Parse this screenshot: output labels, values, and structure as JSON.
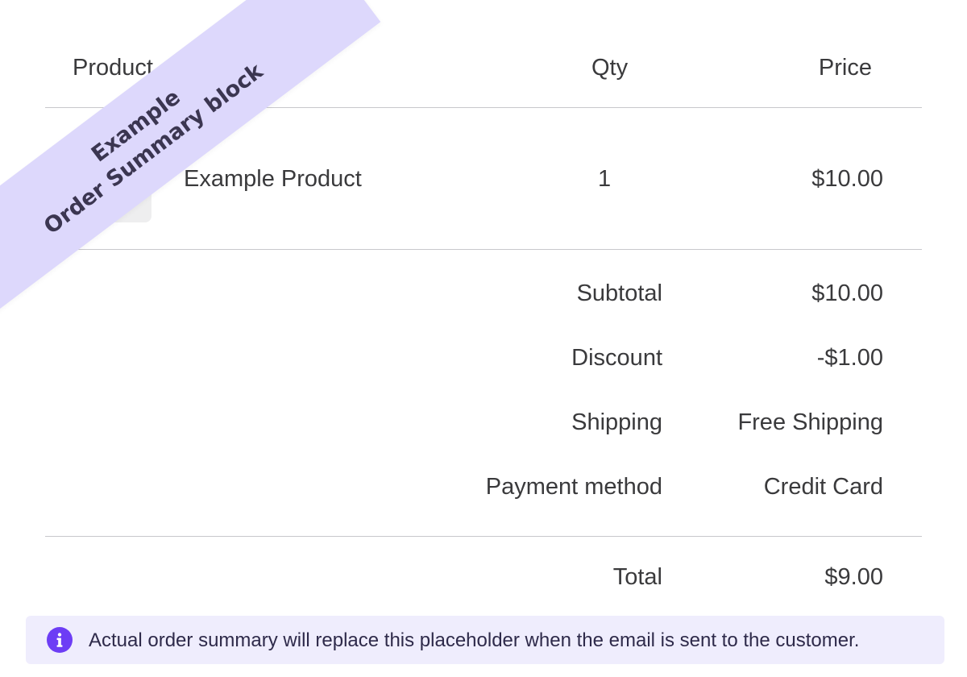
{
  "table": {
    "headers": {
      "product": "Product",
      "qty": "Qty",
      "price": "Price"
    },
    "items": [
      {
        "name": "Example Product",
        "qty": "1",
        "price": "$10.00",
        "thumbnail_icon": "image-placeholder-icon"
      }
    ]
  },
  "summary": {
    "rows": [
      {
        "label": "Subtotal",
        "value": "$10.00"
      },
      {
        "label": "Discount",
        "value": "-$1.00"
      },
      {
        "label": "Shipping",
        "value": "Free Shipping"
      },
      {
        "label": "Payment method",
        "value": "Credit Card"
      }
    ],
    "total": {
      "label": "Total",
      "value": "$9.00"
    }
  },
  "notice": {
    "icon": "info-icon",
    "text": "Actual order summary will replace this placeholder when the email is sent to the customer."
  },
  "ribbon": {
    "line1": "Example",
    "line2": "Order Summary block"
  },
  "colors": {
    "accent": "#6d3df5",
    "notice_bg": "#efedfd",
    "ribbon_bg": "#ddd8fc",
    "divider": "#c8c8cc",
    "text": "#3a3a3c"
  }
}
